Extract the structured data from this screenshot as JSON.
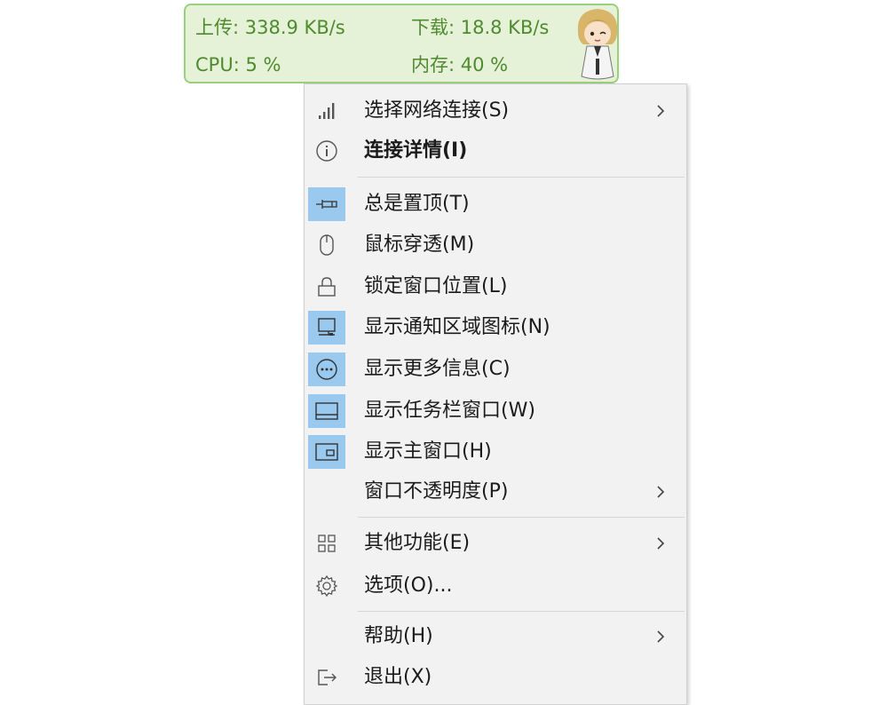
{
  "widget": {
    "upload": "上传: 338.9 KB/s",
    "download": "下载: 18.8 KB/s",
    "cpu": "CPU: 5 %",
    "memory": "内存: 40 %",
    "accent": "#4f8a2e"
  },
  "menu": {
    "items": [
      {
        "label": "选择网络连接(S)",
        "icon": "signal-bars-icon",
        "checked": false,
        "submenu": true
      },
      {
        "label": "连接详情(I)",
        "icon": "info-icon",
        "checked": false,
        "submenu": false,
        "bold": true
      },
      {
        "label": "总是置顶(T)",
        "icon": "pin-icon",
        "checked": true,
        "submenu": false
      },
      {
        "label": "鼠标穿透(M)",
        "icon": "mouse-icon",
        "checked": false,
        "submenu": false
      },
      {
        "label": "锁定窗口位置(L)",
        "icon": "lock-icon",
        "checked": false,
        "submenu": false
      },
      {
        "label": "显示通知区域图标(N)",
        "icon": "notification-area-icon",
        "checked": true,
        "submenu": false
      },
      {
        "label": "显示更多信息(C)",
        "icon": "more-info-icon",
        "checked": true,
        "submenu": false
      },
      {
        "label": "显示任务栏窗口(W)",
        "icon": "taskbar-window-icon",
        "checked": true,
        "submenu": false
      },
      {
        "label": "显示主窗口(H)",
        "icon": "main-window-icon",
        "checked": true,
        "submenu": false
      },
      {
        "label": "窗口不透明度(P)",
        "icon": "",
        "checked": false,
        "submenu": true
      },
      {
        "label": "其他功能(E)",
        "icon": "grid-icon",
        "checked": false,
        "submenu": true
      },
      {
        "label": "选项(O)...",
        "icon": "gear-icon",
        "checked": false,
        "submenu": false
      },
      {
        "label": "帮助(H)",
        "icon": "",
        "checked": false,
        "submenu": true
      },
      {
        "label": "退出(X)",
        "icon": "exit-icon",
        "checked": false,
        "submenu": false
      }
    ],
    "checked_color": "#99c9ee"
  }
}
